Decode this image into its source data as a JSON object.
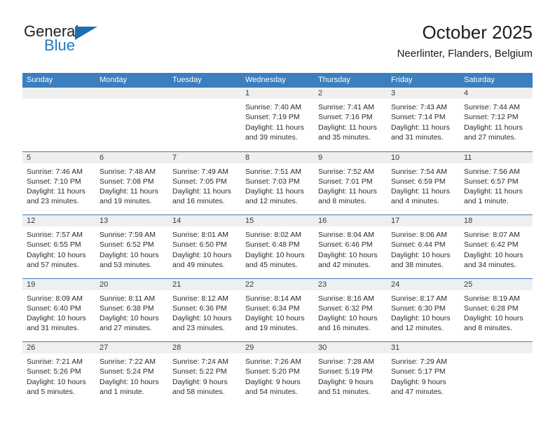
{
  "logo": {
    "word_top": "General",
    "word_bottom": "Blue",
    "triangle_icon": "triangle-icon",
    "blue": "#1a6fb5"
  },
  "header": {
    "title": "October 2025",
    "subtitle": "Neerlinter, Flanders, Belgium"
  },
  "theme": {
    "header_blue": "#3b7fbe",
    "day_band_gray": "#efefef"
  },
  "weekdays": [
    "Sunday",
    "Monday",
    "Tuesday",
    "Wednesday",
    "Thursday",
    "Friday",
    "Saturday"
  ],
  "weeks": [
    [
      {
        "day": "",
        "lines": []
      },
      {
        "day": "",
        "lines": []
      },
      {
        "day": "",
        "lines": []
      },
      {
        "day": "1",
        "lines": [
          "Sunrise: 7:40 AM",
          "Sunset: 7:19 PM",
          "Daylight: 11 hours",
          "and 39 minutes."
        ]
      },
      {
        "day": "2",
        "lines": [
          "Sunrise: 7:41 AM",
          "Sunset: 7:16 PM",
          "Daylight: 11 hours",
          "and 35 minutes."
        ]
      },
      {
        "day": "3",
        "lines": [
          "Sunrise: 7:43 AM",
          "Sunset: 7:14 PM",
          "Daylight: 11 hours",
          "and 31 minutes."
        ]
      },
      {
        "day": "4",
        "lines": [
          "Sunrise: 7:44 AM",
          "Sunset: 7:12 PM",
          "Daylight: 11 hours",
          "and 27 minutes."
        ]
      }
    ],
    [
      {
        "day": "5",
        "lines": [
          "Sunrise: 7:46 AM",
          "Sunset: 7:10 PM",
          "Daylight: 11 hours",
          "and 23 minutes."
        ]
      },
      {
        "day": "6",
        "lines": [
          "Sunrise: 7:48 AM",
          "Sunset: 7:08 PM",
          "Daylight: 11 hours",
          "and 19 minutes."
        ]
      },
      {
        "day": "7",
        "lines": [
          "Sunrise: 7:49 AM",
          "Sunset: 7:05 PM",
          "Daylight: 11 hours",
          "and 16 minutes."
        ]
      },
      {
        "day": "8",
        "lines": [
          "Sunrise: 7:51 AM",
          "Sunset: 7:03 PM",
          "Daylight: 11 hours",
          "and 12 minutes."
        ]
      },
      {
        "day": "9",
        "lines": [
          "Sunrise: 7:52 AM",
          "Sunset: 7:01 PM",
          "Daylight: 11 hours",
          "and 8 minutes."
        ]
      },
      {
        "day": "10",
        "lines": [
          "Sunrise: 7:54 AM",
          "Sunset: 6:59 PM",
          "Daylight: 11 hours",
          "and 4 minutes."
        ]
      },
      {
        "day": "11",
        "lines": [
          "Sunrise: 7:56 AM",
          "Sunset: 6:57 PM",
          "Daylight: 11 hours",
          "and 1 minute."
        ]
      }
    ],
    [
      {
        "day": "12",
        "lines": [
          "Sunrise: 7:57 AM",
          "Sunset: 6:55 PM",
          "Daylight: 10 hours",
          "and 57 minutes."
        ]
      },
      {
        "day": "13",
        "lines": [
          "Sunrise: 7:59 AM",
          "Sunset: 6:52 PM",
          "Daylight: 10 hours",
          "and 53 minutes."
        ]
      },
      {
        "day": "14",
        "lines": [
          "Sunrise: 8:01 AM",
          "Sunset: 6:50 PM",
          "Daylight: 10 hours",
          "and 49 minutes."
        ]
      },
      {
        "day": "15",
        "lines": [
          "Sunrise: 8:02 AM",
          "Sunset: 6:48 PM",
          "Daylight: 10 hours",
          "and 45 minutes."
        ]
      },
      {
        "day": "16",
        "lines": [
          "Sunrise: 8:04 AM",
          "Sunset: 6:46 PM",
          "Daylight: 10 hours",
          "and 42 minutes."
        ]
      },
      {
        "day": "17",
        "lines": [
          "Sunrise: 8:06 AM",
          "Sunset: 6:44 PM",
          "Daylight: 10 hours",
          "and 38 minutes."
        ]
      },
      {
        "day": "18",
        "lines": [
          "Sunrise: 8:07 AM",
          "Sunset: 6:42 PM",
          "Daylight: 10 hours",
          "and 34 minutes."
        ]
      }
    ],
    [
      {
        "day": "19",
        "lines": [
          "Sunrise: 8:09 AM",
          "Sunset: 6:40 PM",
          "Daylight: 10 hours",
          "and 31 minutes."
        ]
      },
      {
        "day": "20",
        "lines": [
          "Sunrise: 8:11 AM",
          "Sunset: 6:38 PM",
          "Daylight: 10 hours",
          "and 27 minutes."
        ]
      },
      {
        "day": "21",
        "lines": [
          "Sunrise: 8:12 AM",
          "Sunset: 6:36 PM",
          "Daylight: 10 hours",
          "and 23 minutes."
        ]
      },
      {
        "day": "22",
        "lines": [
          "Sunrise: 8:14 AM",
          "Sunset: 6:34 PM",
          "Daylight: 10 hours",
          "and 19 minutes."
        ]
      },
      {
        "day": "23",
        "lines": [
          "Sunrise: 8:16 AM",
          "Sunset: 6:32 PM",
          "Daylight: 10 hours",
          "and 16 minutes."
        ]
      },
      {
        "day": "24",
        "lines": [
          "Sunrise: 8:17 AM",
          "Sunset: 6:30 PM",
          "Daylight: 10 hours",
          "and 12 minutes."
        ]
      },
      {
        "day": "25",
        "lines": [
          "Sunrise: 8:19 AM",
          "Sunset: 6:28 PM",
          "Daylight: 10 hours",
          "and 8 minutes."
        ]
      }
    ],
    [
      {
        "day": "26",
        "lines": [
          "Sunrise: 7:21 AM",
          "Sunset: 5:26 PM",
          "Daylight: 10 hours",
          "and 5 minutes."
        ]
      },
      {
        "day": "27",
        "lines": [
          "Sunrise: 7:22 AM",
          "Sunset: 5:24 PM",
          "Daylight: 10 hours",
          "and 1 minute."
        ]
      },
      {
        "day": "28",
        "lines": [
          "Sunrise: 7:24 AM",
          "Sunset: 5:22 PM",
          "Daylight: 9 hours",
          "and 58 minutes."
        ]
      },
      {
        "day": "29",
        "lines": [
          "Sunrise: 7:26 AM",
          "Sunset: 5:20 PM",
          "Daylight: 9 hours",
          "and 54 minutes."
        ]
      },
      {
        "day": "30",
        "lines": [
          "Sunrise: 7:28 AM",
          "Sunset: 5:19 PM",
          "Daylight: 9 hours",
          "and 51 minutes."
        ]
      },
      {
        "day": "31",
        "lines": [
          "Sunrise: 7:29 AM",
          "Sunset: 5:17 PM",
          "Daylight: 9 hours",
          "and 47 minutes."
        ]
      },
      {
        "day": "",
        "lines": []
      }
    ]
  ]
}
